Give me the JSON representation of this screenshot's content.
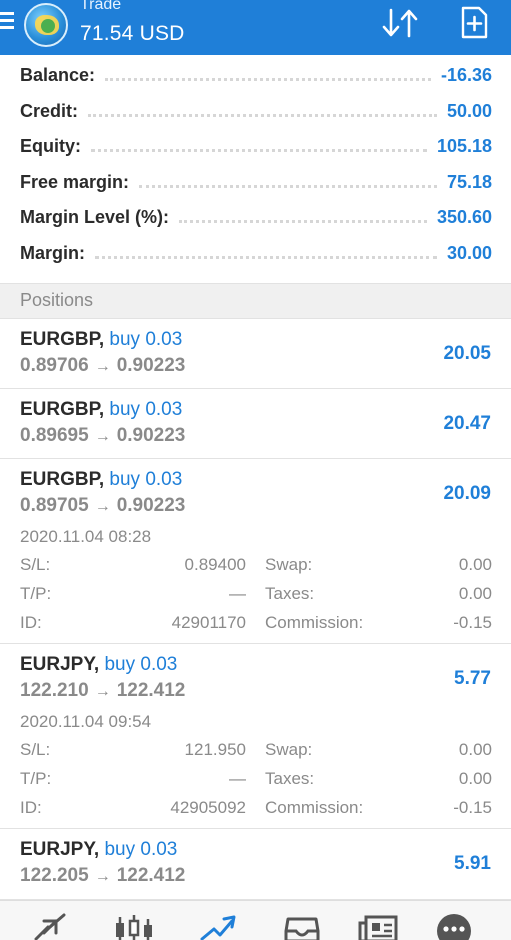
{
  "header": {
    "section": "Trade",
    "summary": "71.54 USD",
    "icons": [
      "menu-icon",
      "metatrader-logo",
      "sort-icon",
      "new-order-icon"
    ]
  },
  "summary": [
    {
      "label": "Balance:",
      "value": "-16.36"
    },
    {
      "label": "Credit:",
      "value": "50.00"
    },
    {
      "label": "Equity:",
      "value": "105.18"
    },
    {
      "label": "Free margin:",
      "value": "75.18"
    },
    {
      "label": "Margin Level (%):",
      "value": "350.60"
    },
    {
      "label": "Margin:",
      "value": "30.00"
    }
  ],
  "positions_header": "Positions",
  "positions": [
    {
      "symbol": "EURGBP,",
      "action": "buy 0.03",
      "open": "0.89706",
      "arrow": "→",
      "current": "0.90223",
      "profit": "20.05"
    },
    {
      "symbol": "EURGBP,",
      "action": "buy 0.03",
      "open": "0.89695",
      "arrow": "→",
      "current": "0.90223",
      "profit": "20.47"
    },
    {
      "symbol": "EURGBP,",
      "action": "buy 0.03",
      "open": "0.89705",
      "arrow": "→",
      "current": "0.90223",
      "profit": "20.09",
      "details": {
        "date": "2020.11.04 08:28",
        "rows": [
          {
            "label1": "S/L:",
            "value1": "0.89400",
            "label2": "Swap:",
            "value2": "0.00"
          },
          {
            "label1": "T/P:",
            "value1": "—",
            "label2": "Taxes:",
            "value2": "0.00"
          },
          {
            "label1": "ID:",
            "value1": "42901170",
            "label2": "Commission:",
            "value2": "-0.15"
          }
        ]
      }
    },
    {
      "symbol": "EURJPY,",
      "action": "buy 0.03",
      "open": "122.210",
      "arrow": "→",
      "current": "122.412",
      "profit": "5.77",
      "details": {
        "date": "2020.11.04 09:54",
        "rows": [
          {
            "label1": "S/L:",
            "value1": "121.950",
            "label2": "Swap:",
            "value2": "0.00"
          },
          {
            "label1": "T/P:",
            "value1": "—",
            "label2": "Taxes:",
            "value2": "0.00"
          },
          {
            "label1": "ID:",
            "value1": "42905092",
            "label2": "Commission:",
            "value2": "-0.15"
          }
        ]
      }
    },
    {
      "symbol": "EURJPY,",
      "action": "buy 0.03",
      "open": "122.205",
      "arrow": "→",
      "current": "122.412",
      "profit": "5.91"
    }
  ],
  "bottom_nav": [
    "quotes-icon",
    "chart-icon",
    "trade-icon",
    "history-icon",
    "news-icon",
    "messages-icon"
  ],
  "colors": {
    "accent": "#1f7fd8",
    "text": "#2b2b2b",
    "muted": "#8a8a8a"
  }
}
